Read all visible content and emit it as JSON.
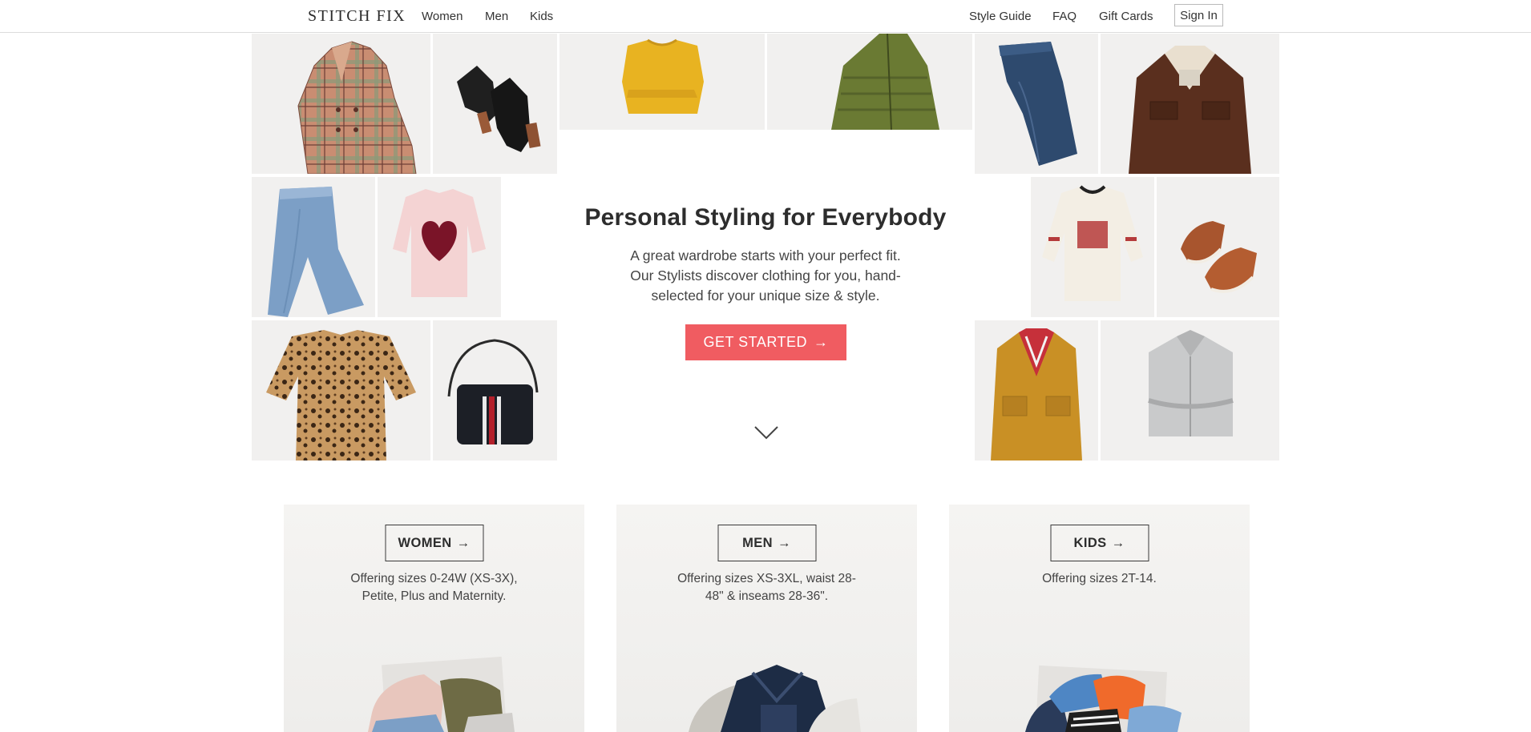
{
  "nav": {
    "logo": "STITCH FIX",
    "left_links": [
      "Women",
      "Men",
      "Kids"
    ],
    "right_links": [
      "Style Guide",
      "FAQ",
      "Gift Cards"
    ],
    "sign_in": "Sign In"
  },
  "hero": {
    "title": "Personal Styling for Everybody",
    "description_lines": [
      "A great wardrobe starts with your perfect fit.",
      "Our Stylists discover clothing for you, hand-",
      "selected for your unique size & style."
    ],
    "cta_label": "GET STARTED",
    "tiles": [
      "plaid-coat",
      "black-ankle-boots",
      "yellow-sweater",
      "green-puffer-jacket",
      "dark-denim-jeans",
      "brown-corduroy-jacket",
      "light-denim-jeans",
      "pink-heart-sweater",
      "graphic-long-sleeve-tee",
      "brown-leather-sneakers",
      "leopard-print-blouse",
      "black-crossbody-bag",
      "mustard-shirt-jacket",
      "grey-button-down-shirt"
    ]
  },
  "categories": [
    {
      "label": "WOMEN",
      "description_lines": [
        "Offering sizes 0-24W (XS-3X),",
        "Petite, Plus and Maternity."
      ]
    },
    {
      "label": "MEN",
      "description_lines": [
        "Offering sizes XS-3XL, waist 28-",
        "48\" & inseams 28-36\"."
      ]
    },
    {
      "label": "KIDS",
      "description_lines": [
        "Offering sizes 2T-14."
      ]
    }
  ],
  "colors": {
    "cta": "#f05c61",
    "tile_bg": "#f1f0ef",
    "text": "#333333"
  },
  "icons": {
    "arrow": "→",
    "scroll_down": "chevron-down-icon"
  }
}
